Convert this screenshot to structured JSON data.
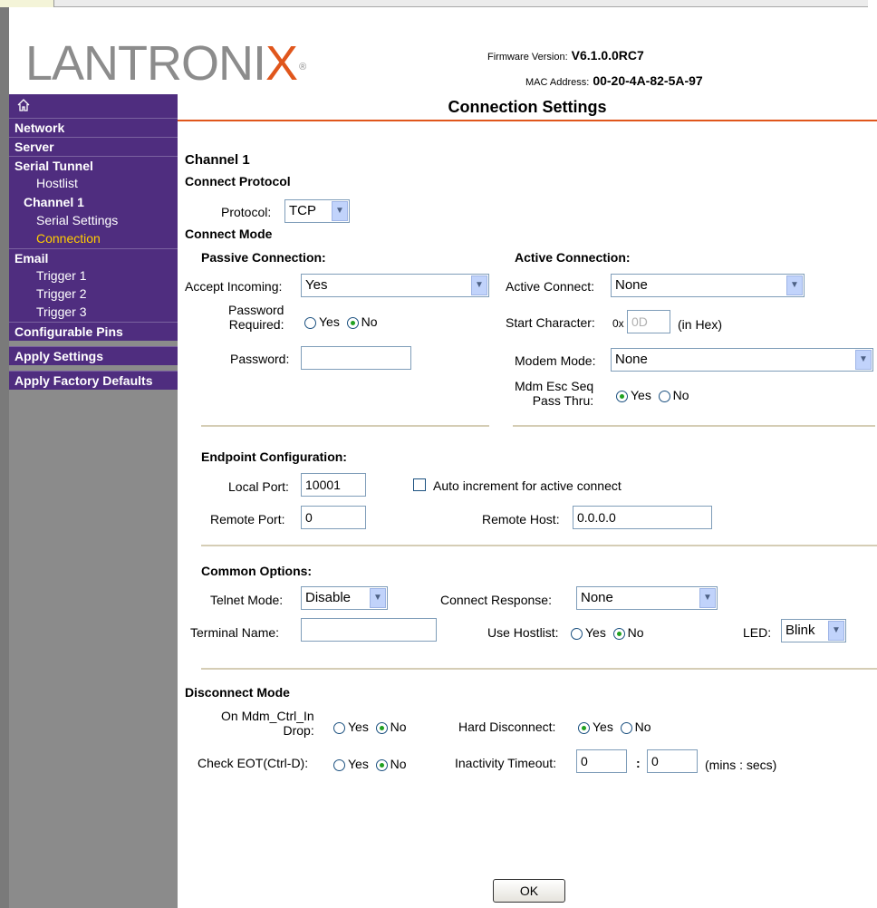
{
  "header": {
    "logo_main": "LANTRONI",
    "logo_x": "X",
    "logo_reg": "®",
    "firmware_label": "Firmware Version:",
    "firmware_value": "V6.1.0.0RC7",
    "mac_label": "MAC Address:",
    "mac_value": "00-20-4A-82-5A-97"
  },
  "sidebar": {
    "home_icon": "home-icon",
    "items": {
      "network": "Network",
      "server": "Server",
      "serial_tunnel": "Serial Tunnel",
      "hostlist": "Hostlist",
      "channel1": "Channel 1",
      "serial_settings": "Serial Settings",
      "connection": "Connection",
      "email": "Email",
      "trigger1": "Trigger 1",
      "trigger2": "Trigger 2",
      "trigger3": "Trigger 3",
      "configurable_pins": "Configurable Pins",
      "apply_settings": "Apply Settings",
      "apply_factory": "Apply Factory Defaults"
    }
  },
  "main": {
    "title": "Connection Settings",
    "channel": "Channel 1",
    "connect_protocol": "Connect Protocol",
    "protocol_label": "Protocol:",
    "protocol_value": "TCP",
    "connect_mode": "Connect Mode",
    "passive_title": "Passive Connection:",
    "accept_label": "Accept Incoming:",
    "accept_value": "Yes",
    "password_required_l1": "Password",
    "password_required_l2": "Required:",
    "yes": "Yes",
    "no": "No",
    "password_label": "Password:",
    "password_value": "",
    "active_title": "Active Connection:",
    "active_connect_label": "Active Connect:",
    "active_connect_value": "None",
    "start_char_label": "Start Character:",
    "start_char_prefix": "0x",
    "start_char_value": "0D",
    "start_char_suffix": "(in Hex)",
    "modem_mode_label": "Modem Mode:",
    "modem_mode_value": "None",
    "mdm_esc_l1": "Mdm Esc Seq",
    "mdm_esc_l2": "Pass Thru:",
    "endpoint_title": "Endpoint Configuration:",
    "local_port_label": "Local Port:",
    "local_port_value": "10001",
    "auto_increment_label": "Auto increment for active connect",
    "remote_port_label": "Remote Port:",
    "remote_port_value": "0",
    "remote_host_label": "Remote Host:",
    "remote_host_value": "0.0.0.0",
    "common_title": "Common Options:",
    "telnet_label": "Telnet Mode:",
    "telnet_value": "Disable",
    "connect_response_label": "Connect Response:",
    "connect_response_value": "None",
    "terminal_name_label": "Terminal Name:",
    "terminal_name_value": "",
    "use_hostlist_label": "Use Hostlist:",
    "led_label": "LED:",
    "led_value": "Blink",
    "disconnect_title": "Disconnect Mode",
    "on_mdm_l1": "On Mdm_Ctrl_In",
    "on_mdm_l2": "Drop:",
    "hard_disconnect_label": "Hard Disconnect:",
    "check_eot_label": "Check EOT(Ctrl-D):",
    "inactivity_label": "Inactivity Timeout:",
    "inactivity_min": "0",
    "colon": ":",
    "inactivity_sec": "0",
    "mins_secs": "(mins : secs)",
    "ok": "OK"
  }
}
